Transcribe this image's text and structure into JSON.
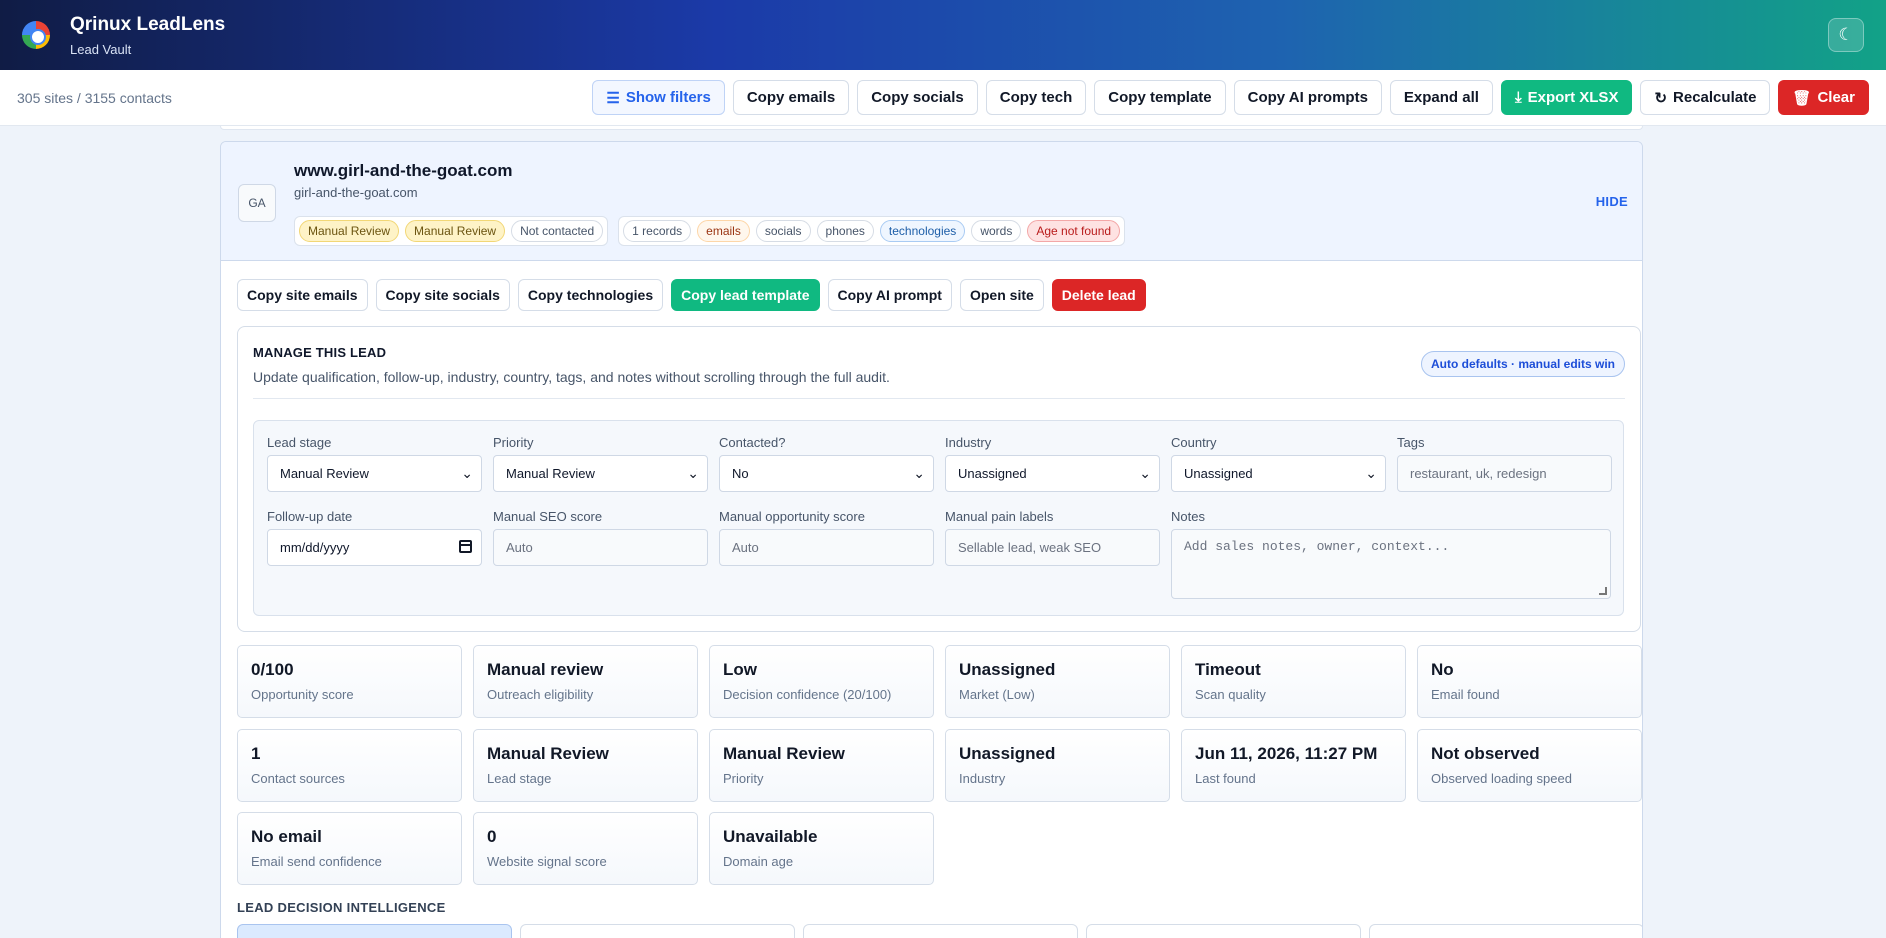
{
  "header": {
    "title": "Qrinux LeadLens",
    "subtitle": "Lead Vault"
  },
  "toolbar": {
    "counts": "305 sites / 3155 contacts",
    "buttons": {
      "show_filters": "Show filters",
      "copy_emails": "Copy emails",
      "copy_socials": "Copy socials",
      "copy_tech": "Copy tech",
      "copy_template": "Copy template",
      "copy_ai_prompts": "Copy AI prompts",
      "expand_all": "Expand all",
      "export_xlsx": "Export XLSX",
      "recalculate": "Recalculate",
      "clear": "Clear"
    }
  },
  "lead": {
    "avatar": "GA",
    "domain": "www.girl-and-the-goat.com",
    "subdomain": "girl-and-the-goat.com",
    "status_pills": [
      "Manual Review",
      "Manual Review",
      "Not contacted"
    ],
    "info_pills": [
      "1 records",
      "emails",
      "socials",
      "phones",
      "technologies",
      "words",
      "Age not found"
    ],
    "hide": "HIDE"
  },
  "actions": {
    "copy_site_emails": "Copy site emails",
    "copy_site_socials": "Copy site socials",
    "copy_technologies": "Copy technologies",
    "copy_lead_template": "Copy lead template",
    "copy_ai_prompt": "Copy AI prompt",
    "open_site": "Open site",
    "delete_lead": "Delete lead"
  },
  "manage": {
    "title": "MANAGE THIS LEAD",
    "description": "Update qualification, follow-up, industry, country, tags, and notes without scrolling through the full audit.",
    "badge": "Auto defaults · manual edits win",
    "fields": {
      "lead_stage": {
        "label": "Lead stage",
        "value": "Manual Review"
      },
      "priority": {
        "label": "Priority",
        "value": "Manual Review"
      },
      "contacted": {
        "label": "Contacted?",
        "value": "No"
      },
      "industry": {
        "label": "Industry",
        "value": "Unassigned"
      },
      "country": {
        "label": "Country",
        "value": "Unassigned"
      },
      "tags": {
        "label": "Tags",
        "placeholder": "restaurant, uk, redesign"
      },
      "followup": {
        "label": "Follow-up date",
        "placeholder": "mm/dd/yyyy"
      },
      "seo": {
        "label": "Manual SEO score",
        "placeholder": "Auto"
      },
      "opportunity": {
        "label": "Manual opportunity score",
        "placeholder": "Auto"
      },
      "pain": {
        "label": "Manual pain labels",
        "placeholder": "Sellable lead, weak SEO"
      },
      "notes": {
        "label": "Notes",
        "placeholder": "Add sales notes, owner, context..."
      }
    }
  },
  "metrics": [
    {
      "value": "0/100",
      "label": "Opportunity score"
    },
    {
      "value": "Manual review",
      "label": "Outreach eligibility"
    },
    {
      "value": "Low",
      "label": "Decision confidence (20/100)"
    },
    {
      "value": "Unassigned",
      "label": "Market (Low)"
    },
    {
      "value": "Timeout",
      "label": "Scan quality"
    },
    {
      "value": "No",
      "label": "Email found"
    },
    {
      "value": "1",
      "label": "Contact sources"
    },
    {
      "value": "Manual Review",
      "label": "Lead stage"
    },
    {
      "value": "Manual Review",
      "label": "Priority"
    },
    {
      "value": "Unassigned",
      "label": "Industry"
    },
    {
      "value": "Jun 11, 2026, 11:27 PM",
      "label": "Last found"
    },
    {
      "value": "Not observed",
      "label": "Observed loading speed"
    },
    {
      "value": "No email",
      "label": "Email send confidence"
    },
    {
      "value": "0",
      "label": "Website signal score"
    },
    {
      "value": "Unavailable",
      "label": "Domain age"
    }
  ],
  "intelligence": {
    "title": "LEAD DECISION INTELLIGENCE"
  },
  "colors": {
    "accent": "#2563eb",
    "success": "#10b981",
    "danger": "#dc2626"
  }
}
